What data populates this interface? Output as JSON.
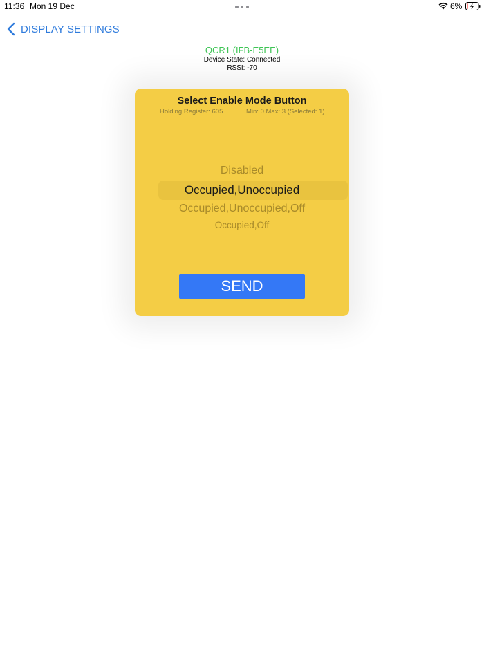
{
  "status_bar": {
    "time": "11:36",
    "date": "Mon 19 Dec",
    "battery_percent": "6%",
    "icons": [
      "wifi-icon",
      "battery-charging-icon",
      "multitasking-dots-icon"
    ]
  },
  "nav": {
    "back_label": "DISPLAY SETTINGS",
    "back_icon": "chevron-left-icon",
    "accent_color": "#2f7bdc"
  },
  "device": {
    "name": "QCR1 (IFB-E5EE)",
    "state": "Device State: Connected",
    "rssi": "RSSI: -70",
    "name_color": "#3ec455"
  },
  "modal": {
    "title": "Select Enable Mode Button",
    "holding_register": "Holding Register: 605",
    "range": "Min: 0 Max: 3 (Selected: 1)",
    "background_color": "#f4cd45",
    "options": [
      "Disabled",
      "Occupied,Unoccupied",
      "Occupied,Unoccupied,Off",
      "Occupied,Off"
    ],
    "selected_index": 1,
    "send_label": "SEND",
    "send_color": "#3478f6"
  }
}
